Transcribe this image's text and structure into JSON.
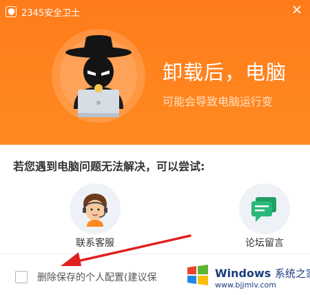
{
  "window": {
    "title": "2345安全卫士",
    "app_icon": "shield-icon",
    "close_icon": "close-icon"
  },
  "banner": {
    "illustration": "hacker-with-laptop",
    "headline": "卸载后，电脑",
    "subline": "可能会导致电脑运行变"
  },
  "help": {
    "prompt": "若您遇到电脑问题无法解决，可以尝试:",
    "services": [
      {
        "label": "联系客服",
        "icon": "customer-service-icon"
      },
      {
        "label": "论坛留言",
        "icon": "forum-message-icon"
      }
    ]
  },
  "options": {
    "delete_config_label": "删除保存的个人配置(建议保",
    "delete_config_checked": false
  },
  "annotation": {
    "arrow_color": "#e02020"
  },
  "watermark": {
    "brand": "Windows",
    "brand_cn": "系统之家",
    "url": "www.bjjmlv.com"
  },
  "colors": {
    "header": "#ff8a21",
    "accent_green": "#2bb97a"
  }
}
